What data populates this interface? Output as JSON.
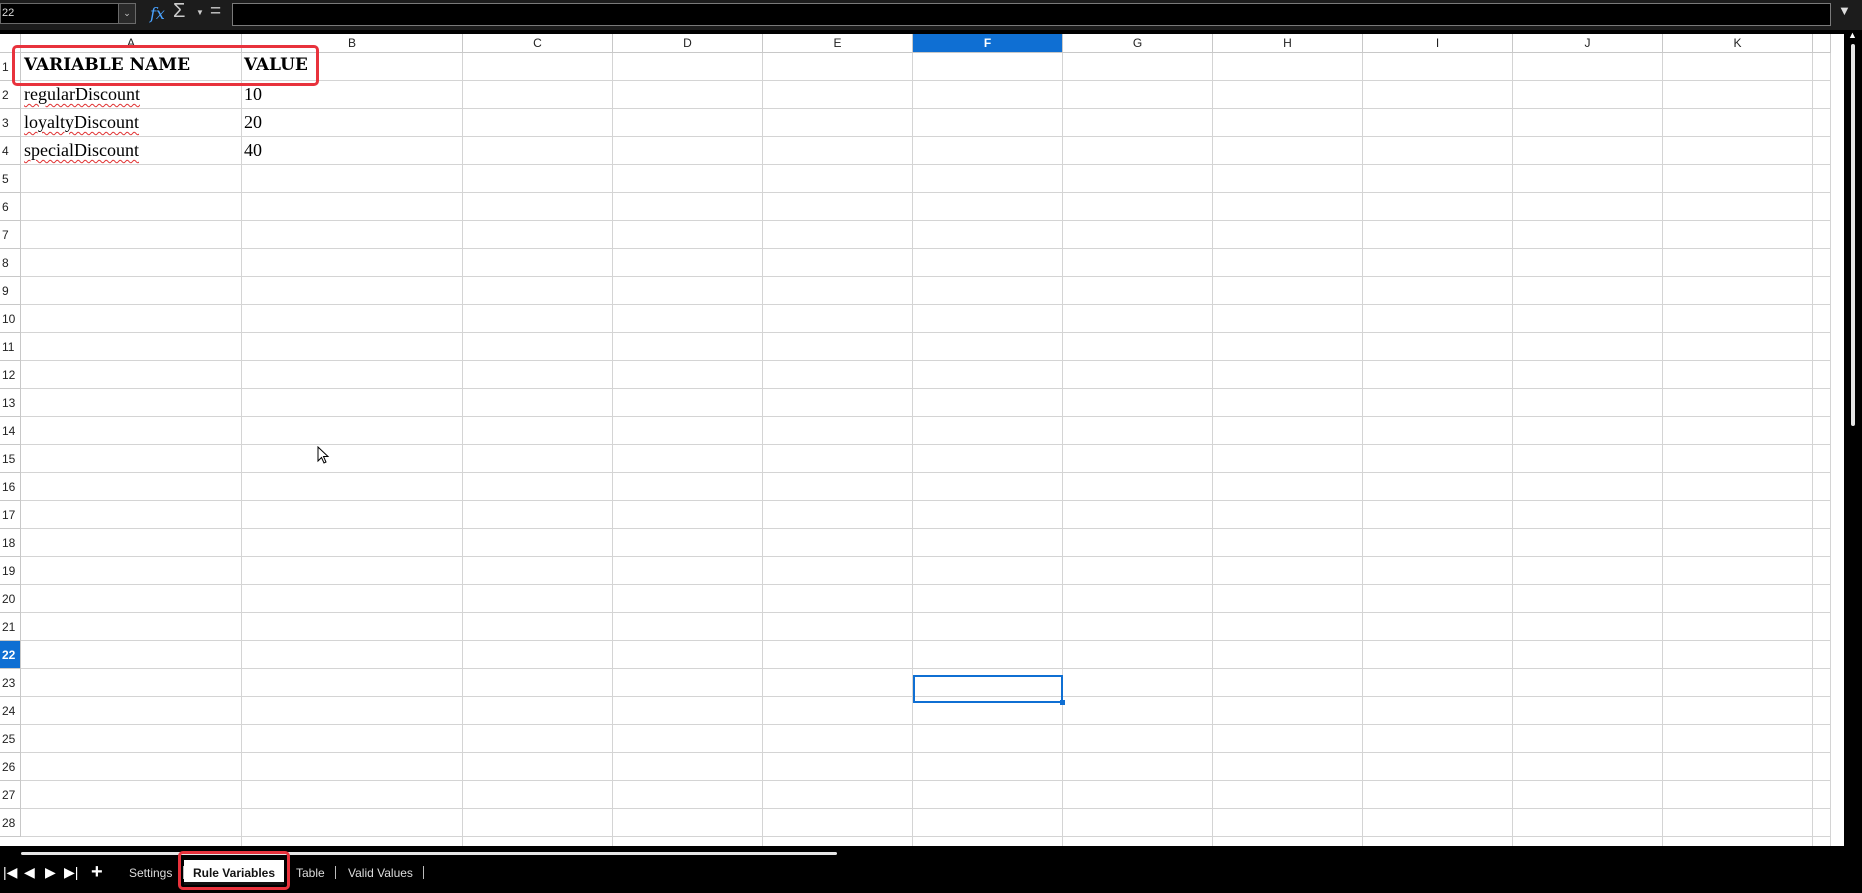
{
  "formula_bar": {
    "name_box": "22",
    "formula_input": "",
    "icons": {
      "function": "fx",
      "sum": "Σ",
      "equals": "="
    }
  },
  "columns": [
    "A",
    "B",
    "C",
    "D",
    "E",
    "F",
    "G",
    "H",
    "I",
    "J",
    "K"
  ],
  "rows": [
    "1",
    "2",
    "3",
    "4",
    "5",
    "6",
    "7",
    "8",
    "9",
    "10",
    "11",
    "12",
    "13",
    "14",
    "15",
    "16",
    "17",
    "18",
    "19",
    "20",
    "21",
    "22",
    "23",
    "24",
    "25",
    "26",
    "27",
    "28"
  ],
  "selected": {
    "column": "F",
    "row": "22"
  },
  "cells": {
    "A1": "VARIABLE NAME",
    "B1": "VALUE",
    "A2": "regularDiscount",
    "B2": "10",
    "A3": "loyaltyDiscount",
    "B3": "20",
    "A4": "specialDiscount",
    "B4": "40"
  },
  "sheet_tabs": {
    "tabs": [
      "Settings",
      "Rule Variables",
      "Table",
      "Valid Values"
    ],
    "active": "Rule Variables",
    "add_label": "+"
  },
  "colors": {
    "accent": "#0f6fd3",
    "annotation": "#e8323c"
  }
}
